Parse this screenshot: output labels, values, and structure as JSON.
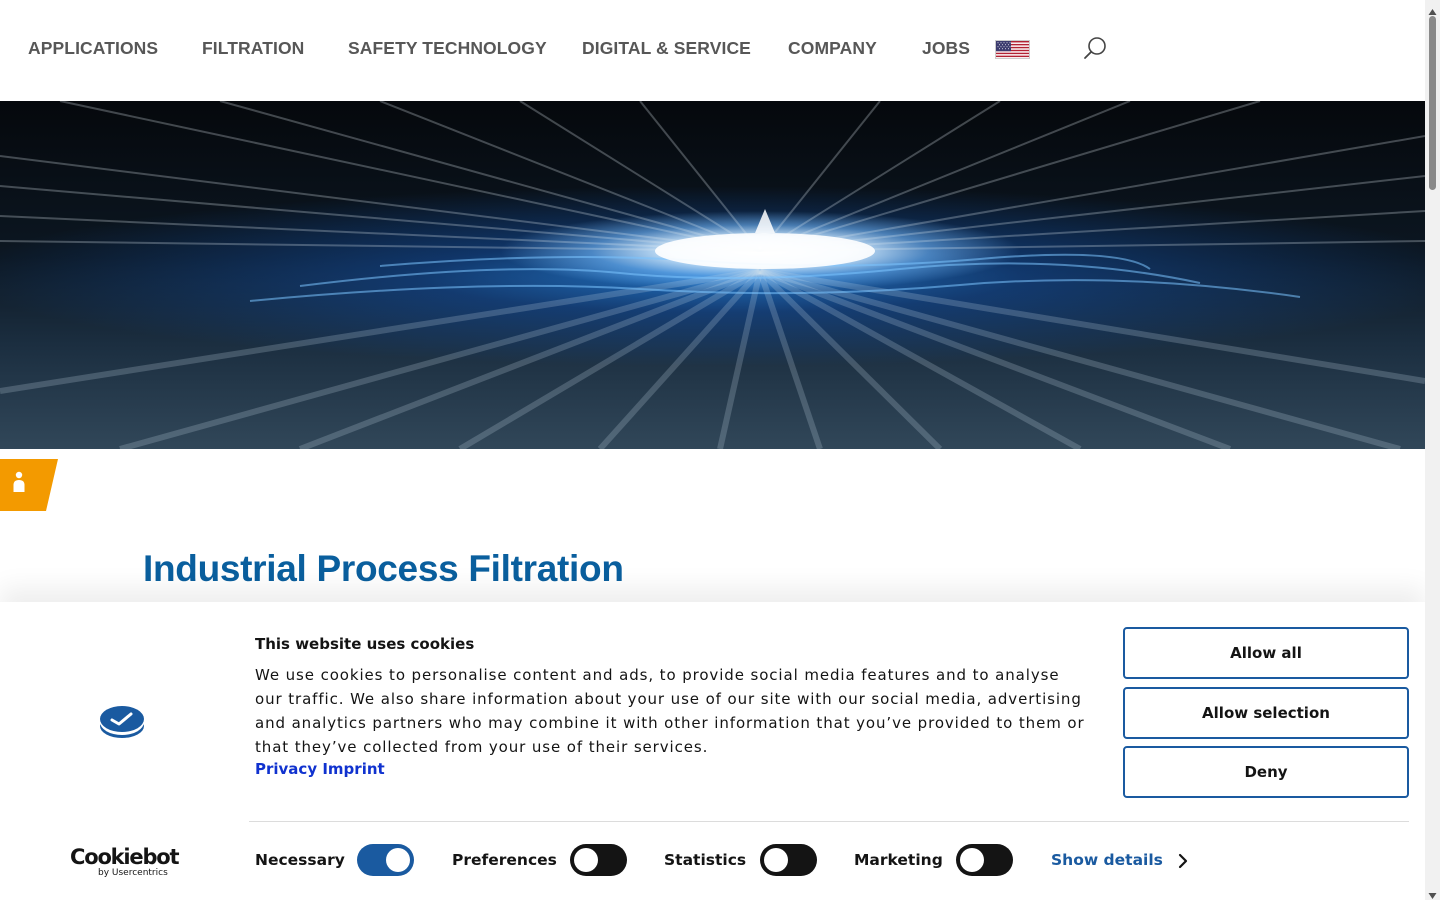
{
  "nav": {
    "items": [
      {
        "label": "APPLICATIONS"
      },
      {
        "label": "FILTRATION"
      },
      {
        "label": "SAFETY TECHNOLOGY"
      },
      {
        "label": "DIGITAL & SERVICE"
      },
      {
        "label": "COMPANY"
      },
      {
        "label": "JOBS"
      }
    ],
    "language_flag_icon": "us-flag-icon",
    "search_icon": "search-icon"
  },
  "hero": {
    "image_icon": "light-burst-hero-image"
  },
  "accessibility_tab": {
    "icon": "person-icon",
    "color": "#f39a00"
  },
  "page": {
    "title": "Industrial Process Filtration",
    "title_color": "#0a5f9e"
  },
  "cookie_banner": {
    "title": "This website uses cookies",
    "text": "We use cookies to personalise content and ads, to provide social media features and to analyse our traffic. We also share information about your use of our site with our social media, advertising and an­alytics partners who may combine it with other information that you’ve provided to them or that they’ve collected from your use of their services.",
    "links": {
      "privacy": "Privacy",
      "imprint": "Imprint"
    },
    "buttons": {
      "allow_all": "Allow all",
      "allow_selection": "Allow selection",
      "deny": "Deny"
    },
    "brand": {
      "name": "Cookiebot",
      "by": "by Usercentrics"
    },
    "toggles": [
      {
        "label": "Necessary",
        "on": true
      },
      {
        "label": "Preferences",
        "on": false
      },
      {
        "label": "Statistics",
        "on": false
      },
      {
        "label": "Marketing",
        "on": false
      }
    ],
    "show_details": "Show details",
    "accent_color": "#1a5aa0",
    "link_color": "#1032cf"
  }
}
